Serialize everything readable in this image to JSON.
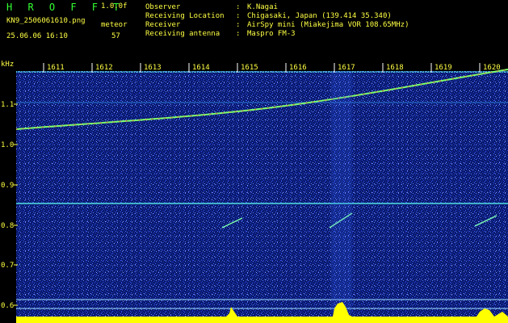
{
  "header": {
    "title": "H R O F F T",
    "version": "1.0.0f",
    "file_name": "KN9_2506061610.png",
    "mode": "meteor",
    "timestamp": "25.06.06 16:10",
    "count": "57"
  },
  "info": [
    {
      "label": "Observer",
      "value": "K.Nagai"
    },
    {
      "label": "Receiving Location",
      "value": "Chigasaki, Japan (139.414 35.340)"
    },
    {
      "label": "Receiver",
      "value": "AirSpy mini (Miakejima VOR 108.65MHz)"
    },
    {
      "label": "Receiving antenna",
      "value": "Maspro FM-3"
    }
  ],
  "axis": {
    "unit": "kHz",
    "y_ticks": [
      "1.1",
      "1.0",
      "0.9",
      "0.8",
      "0.7",
      "0.6"
    ],
    "minute_labels": [
      "1611",
      "1612",
      "1613",
      "1614",
      "1615",
      "1616",
      "1617",
      "1618",
      "1619",
      "1620"
    ]
  },
  "colors": {
    "background": "#000000",
    "spectrogram": "#0a1a6e",
    "text_yellow": "#ffff44",
    "title_green": "#33ff33"
  }
}
